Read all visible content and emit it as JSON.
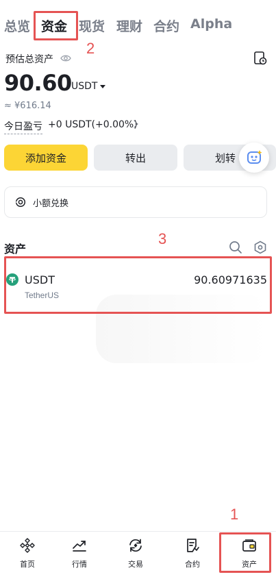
{
  "top_tabs": [
    "总览",
    "资金",
    "现货",
    "理财",
    "合约",
    "Alpha"
  ],
  "active_tab": "资金",
  "annotations": {
    "one": "1",
    "two": "2",
    "three": "3"
  },
  "summary": {
    "estimated_label": "预估总资产",
    "balance": "90.60",
    "unit": "USDT",
    "fiat": "≈ ¥616.14",
    "pnl_label": "今日盈亏",
    "pnl_value": "+0 USDT(+0.00%)"
  },
  "actions": {
    "add": "添加资金",
    "withdraw": "转出",
    "transfer": "划转"
  },
  "small_convert": {
    "label": "小额兑换"
  },
  "assets_section": {
    "title": "资产",
    "items": [
      {
        "symbol": "USDT",
        "name": "TetherUS",
        "amount": "90.60971635"
      }
    ]
  },
  "bottom_nav": {
    "items": [
      {
        "label": "首页",
        "icon": "home-diamond-icon"
      },
      {
        "label": "行情",
        "icon": "markets-chart-icon"
      },
      {
        "label": "交易",
        "icon": "trade-exchange-icon"
      },
      {
        "label": "合约",
        "icon": "futures-doc-icon"
      },
      {
        "label": "资产",
        "icon": "wallet-icon"
      }
    ],
    "active": "资产"
  },
  "colors": {
    "accent": "#fcd535",
    "annotation": "#e55353",
    "usdt": "#26a17b"
  }
}
